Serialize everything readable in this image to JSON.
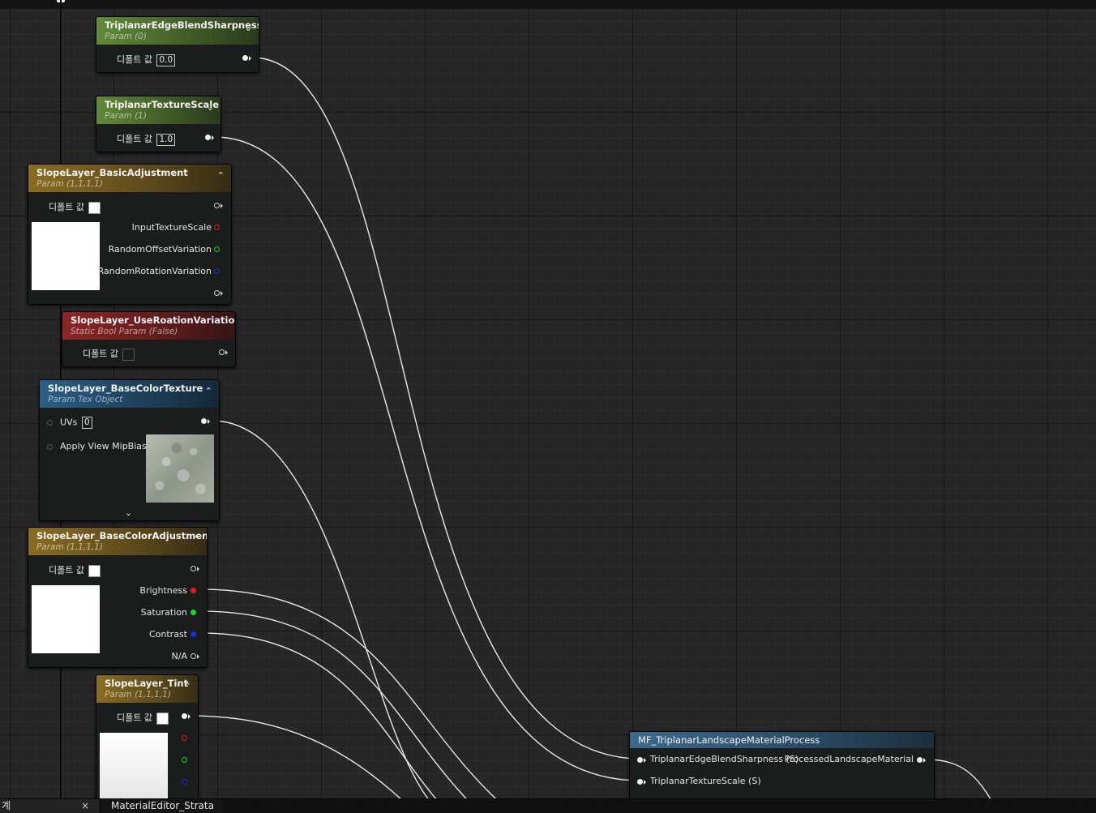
{
  "nodes": {
    "edge_blend": {
      "title": "TriplanarEdgeBlendSharpness",
      "subtitle": "Param (0)",
      "default_label": "디폴트 값",
      "default_value": "0.0"
    },
    "texture_scale": {
      "title": "TriplanarTextureScale",
      "subtitle": "Param (1)",
      "default_label": "디폴트 값",
      "default_value": "1.0"
    },
    "basic_adjust": {
      "title": "SlopeLayer_BasicAdjustment",
      "subtitle": "Param (1,1,1,1)",
      "default_label": "디폴트 값",
      "outputs": [
        "InputTextureScale",
        "RandomOffsetVariation",
        "RandomRotationVariation"
      ]
    },
    "use_rotation": {
      "title": "SlopeLayer_UseRoationVariation",
      "subtitle": "Static Bool Param (False)",
      "default_label": "디폴트 값"
    },
    "base_color_tex": {
      "title": "SlopeLayer_BaseColorTexture",
      "subtitle": "Param Tex Object",
      "uvs_label": "UVs",
      "uvs_value": "0",
      "mip_label": "Apply View MipBias"
    },
    "base_color_adjust": {
      "title": "SlopeLayer_BaseColorAdjustment",
      "subtitle": "Param (1,1,1,1)",
      "default_label": "디폴트 값",
      "outputs": [
        "Brightness",
        "Saturation",
        "Contrast",
        "N/A"
      ]
    },
    "tint": {
      "title": "SlopeLayer_Tint",
      "subtitle": "Param (1,1,1,1)",
      "default_label": "디폴트 값"
    },
    "mf_process": {
      "title": "MF_TriplanarLandscapeMaterialProcess",
      "input1": "TriplanarEdgeBlendSharpness (S)",
      "input2": "TriplanarTextureScale (S)",
      "output": "ProcessedLandscapeMaterial"
    }
  },
  "tabs": {
    "first": "계",
    "second": "MaterialEditor_Strata",
    "close": "×"
  },
  "colors": {
    "param_header": "#628a38",
    "vector_header": "#8a6d22",
    "bool_header": "#8c2626",
    "texture_header": "#2b5f86",
    "function_header": "#3c6a8c",
    "red_pin": "#e01a1a",
    "green_pin": "#18d418",
    "blue_pin": "#1a2ee0"
  }
}
